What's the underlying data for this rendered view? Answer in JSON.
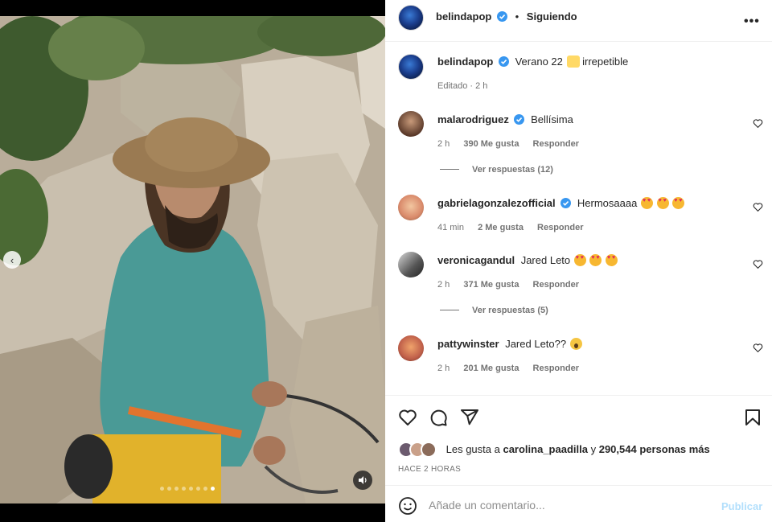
{
  "post": {
    "author": "belindapop",
    "follow_status": "Siguiendo",
    "separator": "•",
    "caption_text_1": "Verano 22",
    "caption_text_2": "irrepetible",
    "caption_meta": "Editado · 2 h"
  },
  "comments": [
    {
      "user": "malarodriguez",
      "verified": true,
      "text": "Bellísima",
      "time": "2 h",
      "likes": "390 Me gusta",
      "reply": "Responder",
      "view_replies": "Ver respuestas (12)"
    },
    {
      "user": "gabrielagonzalezofficial",
      "verified": true,
      "text": "Hermosaaaa",
      "time": "41 min",
      "likes": "2 Me gusta",
      "reply": "Responder"
    },
    {
      "user": "veronicagandul",
      "verified": false,
      "text": "Jared Leto",
      "time": "2 h",
      "likes": "371 Me gusta",
      "reply": "Responder",
      "view_replies": "Ver respuestas (5)"
    },
    {
      "user": "pattywinster",
      "verified": false,
      "text": "Jared Leto??",
      "time": "2 h",
      "likes": "201 Me gusta",
      "reply": "Responder"
    }
  ],
  "likes_line": {
    "prefix": "Les gusta a",
    "user": "carolina_paadilla",
    "connector": "y",
    "count": "290,544 personas más"
  },
  "timestamp": "HACE 2 HORAS",
  "add_comment": {
    "placeholder": "Añade un comentario...",
    "publish": "Publicar"
  },
  "carousel": {
    "total": 8,
    "active_index": 7
  },
  "colors": {
    "verified": "#3897f0",
    "publish_disabled": "#b2dffc"
  }
}
